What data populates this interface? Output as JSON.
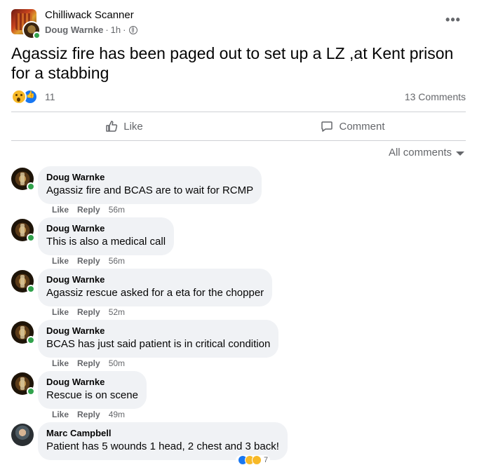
{
  "post": {
    "group_name": "Chilliwack Scanner",
    "author": "Doug Warnke",
    "time": "1h",
    "separator": "·",
    "text": "Agassiz fire has been paged out to set up a LZ ,at Kent prison for a stabbing",
    "reaction_count": "11",
    "comments_count": "13 Comments",
    "more_label": "•••"
  },
  "actions": {
    "like_label": "Like",
    "comment_label": "Comment"
  },
  "filter": {
    "label": "All comments"
  },
  "comments": [
    {
      "name": "Doug Warnke",
      "text": "Agassiz fire and BCAS are to wait for RCMP",
      "like": "Like",
      "reply": "Reply",
      "time": "56m"
    },
    {
      "name": "Doug Warnke",
      "text": "This is also a medical call",
      "like": "Like",
      "reply": "Reply",
      "time": "56m"
    },
    {
      "name": "Doug Warnke",
      "text": "Agassiz rescue asked for a eta for the chopper",
      "like": "Like",
      "reply": "Reply",
      "time": "52m"
    },
    {
      "name": "Doug Warnke",
      "text": "BCAS has just said patient is in critical condition",
      "like": "Like",
      "reply": "Reply",
      "time": "50m"
    },
    {
      "name": "Doug Warnke",
      "text": "Rescue is on scene",
      "like": "Like",
      "reply": "Reply",
      "time": "49m"
    },
    {
      "name": "Marc Campbell",
      "text": "Patient has 5 wounds 1 head, 2 chest and 3 back!",
      "reaction_count": "7"
    }
  ],
  "colors": {
    "accent": "#1877f2",
    "secondary_text": "#65676b",
    "bubble": "#f0f2f5",
    "online": "#31a24c"
  },
  "icons": [
    "globe-icon",
    "more-icon",
    "wow-reaction-icon",
    "like-reaction-icon",
    "thumb-up-icon",
    "comment-icon",
    "caret-down-icon"
  ]
}
